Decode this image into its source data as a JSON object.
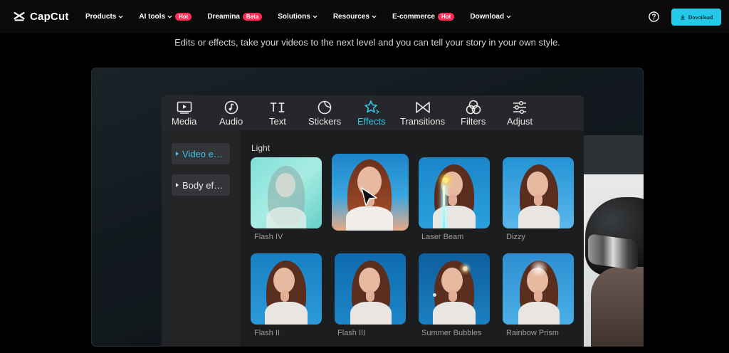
{
  "brand": {
    "name": "CapCut"
  },
  "nav": {
    "items": [
      {
        "label": "Products",
        "chevron": true
      },
      {
        "label": "AI tools",
        "chevron": true,
        "badge": "Hot"
      },
      {
        "label": "Dreamina",
        "badge": "Beta"
      },
      {
        "label": "Solutions",
        "chevron": true
      },
      {
        "label": "Resources",
        "chevron": true
      },
      {
        "label": "E-commerce",
        "badge": "Hot"
      },
      {
        "label": "Download",
        "chevron": true
      }
    ],
    "download_button": "Download"
  },
  "hero": {
    "subtitle": "Edits or effects, take your videos to the next level and you can tell your story in your own style."
  },
  "editor": {
    "tabs": [
      {
        "label": "Media",
        "icon": "play-screen-icon"
      },
      {
        "label": "Audio",
        "icon": "music-note-icon"
      },
      {
        "label": "Text",
        "icon": "text-icon"
      },
      {
        "label": "Stickers",
        "icon": "sticker-icon"
      },
      {
        "label": "Effects",
        "icon": "sparkle-star-icon",
        "active": true
      },
      {
        "label": "Transitions",
        "icon": "bowtie-icon"
      },
      {
        "label": "Filters",
        "icon": "filters-icon"
      },
      {
        "label": "Adjust",
        "icon": "sliders-icon"
      }
    ],
    "rail": [
      {
        "label": "Video e…",
        "active": true
      },
      {
        "label": "Body ef…"
      }
    ],
    "section_title": "Light",
    "effects": [
      {
        "label": "Flash IV"
      },
      {
        "label": ""
      },
      {
        "label": "Laser Beam"
      },
      {
        "label": "Dizzy"
      },
      {
        "label": "Flash II"
      },
      {
        "label": "Flash III"
      },
      {
        "label": "Summer Bubbles"
      },
      {
        "label": "Rainbow Prism"
      }
    ]
  },
  "colors": {
    "accent": "#3cc6e6",
    "button": "#25c9e8",
    "hot": "#fe2c55"
  }
}
